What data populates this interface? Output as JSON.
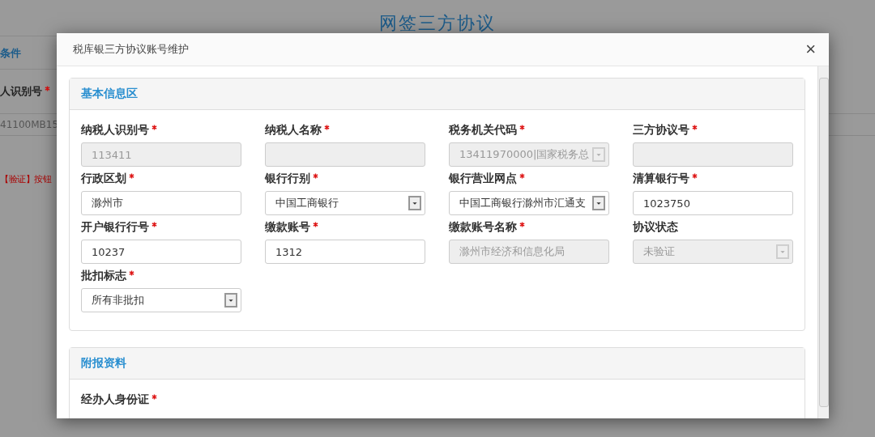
{
  "page": {
    "title": "网签三方协议",
    "section_tab": "条件",
    "field_label": "人识别号",
    "field_required": true,
    "field_value": "41100MB15",
    "hint": "【验证】按钮"
  },
  "dialog": {
    "title": "税库银三方协议账号维护",
    "close": "×",
    "panels": [
      {
        "title": "基本信息区",
        "fields": [
          {
            "label": "纳税人识别号",
            "required": true,
            "kind": "text",
            "disabled": true,
            "value": "113411"
          },
          {
            "label": "纳税人名称",
            "required": true,
            "kind": "text",
            "disabled": true
          },
          {
            "label": "税务机关代码",
            "required": true,
            "kind": "select",
            "disabled": true,
            "value": "13411970000|国家税务总"
          },
          {
            "label": "三方协议号",
            "required": true,
            "kind": "text",
            "disabled": true
          },
          {
            "label": "行政区划",
            "required": true,
            "kind": "text",
            "disabled": false,
            "value": "滁州市"
          },
          {
            "label": "银行行别",
            "required": true,
            "kind": "select",
            "disabled": false,
            "value": "中国工商银行"
          },
          {
            "label": "银行营业网点",
            "required": true,
            "kind": "select",
            "disabled": false,
            "value": "中国工商银行滁州市汇通支"
          },
          {
            "label": "清算银行号",
            "required": true,
            "kind": "text",
            "disabled": false,
            "value": "1023750"
          },
          {
            "label": "开户银行行号",
            "required": true,
            "kind": "text",
            "disabled": false,
            "value": "10237"
          },
          {
            "label": "缴款账号",
            "required": true,
            "kind": "text",
            "disabled": false,
            "value": "1312"
          },
          {
            "label": "缴款账号名称",
            "required": true,
            "kind": "text",
            "disabled": true,
            "value": "滁州市经济和信息化局"
          },
          {
            "label": "协议状态",
            "required": false,
            "kind": "select",
            "disabled": true,
            "value": "未验证"
          },
          {
            "label": "批扣标志",
            "required": true,
            "kind": "select",
            "disabled": false,
            "value": "所有非批扣"
          }
        ]
      },
      {
        "title": "附报资料",
        "fields": [
          {
            "label": "经办人身份证",
            "required": true,
            "kind": "label"
          }
        ]
      }
    ]
  }
}
